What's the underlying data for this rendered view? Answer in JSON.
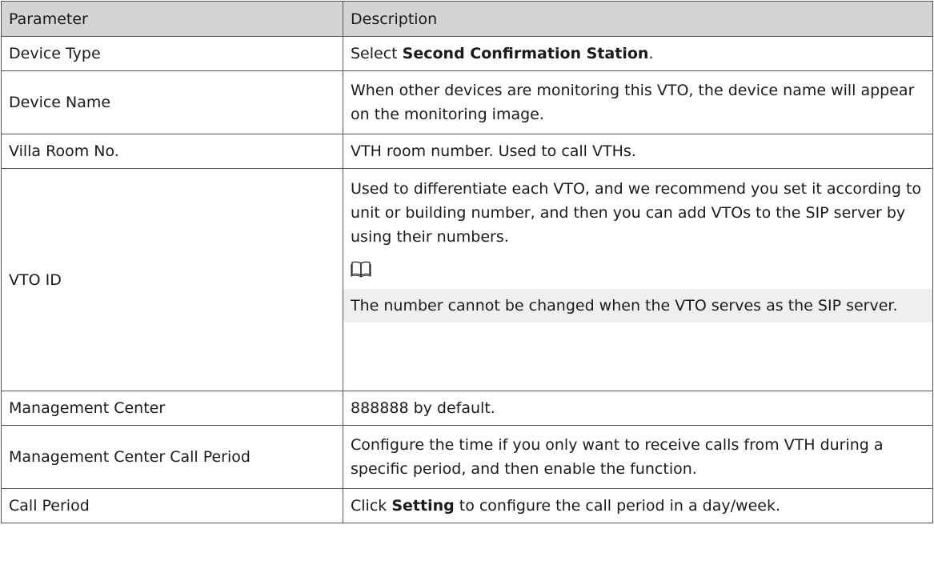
{
  "headers": {
    "parameter": "Parameter",
    "description": "Description"
  },
  "rows": [
    {
      "parameter": "Device Type",
      "desc_prefix": "Select ",
      "desc_bold": "Second Confirmation Station",
      "desc_suffix": "."
    },
    {
      "parameter": "Device Name",
      "desc": "When other devices are monitoring this VTO, the device name will appear on the monitoring image."
    },
    {
      "parameter": "Villa Room No.",
      "desc": "VTH room number. Used to call VTHs."
    },
    {
      "parameter": "VTO ID",
      "desc": "Used to differentiate each VTO, and we recommend you set it according to unit or building number, and then you can add VTOs to the SIP server by using their numbers.",
      "note_icon": "book-icon",
      "note": "The number cannot be changed when the VTO serves as the SIP server."
    },
    {
      "parameter": "Management Center",
      "desc": "888888 by default."
    },
    {
      "parameter": "Management Center Call Period",
      "desc": "Configure the time if you only want to receive calls from VTH during a specific period, and then enable the function."
    },
    {
      "parameter": "Call Period",
      "desc_prefix": "Click ",
      "desc_bold": "Setting",
      "desc_suffix": " to configure the call period in a day/week."
    }
  ]
}
